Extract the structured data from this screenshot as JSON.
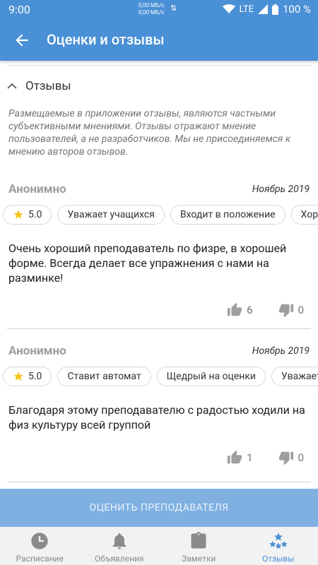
{
  "status": {
    "time": "9:00",
    "net_up": "0,00 МБ/с",
    "net_down": "0,00 МБ/с",
    "network": "LTE",
    "battery": "100 %"
  },
  "appbar": {
    "title": "Оценки и отзывы"
  },
  "section": {
    "title": "Отзывы"
  },
  "disclaimer": "Размещаемые в приложении отзывы, являются частными субъективными мнениями. Отзывы отражают мнение пользователей, а не разработчиков. Мы не присоединяемся к мнению авторов отзывов.",
  "reviews": [
    {
      "author": "Анонимно",
      "date": "Ноябрь 2019",
      "rating": "5.0",
      "tags": [
        "Уважает учащихся",
        "Входит в положение",
        "Хороший"
      ],
      "text": "Очень хороший преподаватель по физре, в хорошей форме. Всегда делает все упражнения с нами на разминке!",
      "likes": "6",
      "dislikes": "0"
    },
    {
      "author": "Анонимно",
      "date": "Ноябрь 2019",
      "rating": "5.0",
      "tags": [
        "Ставит автомат",
        "Щедрый на оценки",
        "Уважает"
      ],
      "text": "Благодаря этому преподавателю с радостью ходили на физ культуру всей группой",
      "likes": "1",
      "dislikes": "0"
    }
  ],
  "rate_button": "ОЦЕНИТЬ ПРЕПОДАВАТЕЛЯ",
  "nav": [
    {
      "label": "Расписание",
      "icon": "clock-icon"
    },
    {
      "label": "Объявления",
      "icon": "bell-icon"
    },
    {
      "label": "Заметки",
      "icon": "clipboard-icon"
    },
    {
      "label": "Отзывы",
      "icon": "reviews-icon"
    }
  ],
  "colors": {
    "primary": "#4a90d6",
    "button": "#7fb0e1",
    "star": "#f5c518"
  }
}
